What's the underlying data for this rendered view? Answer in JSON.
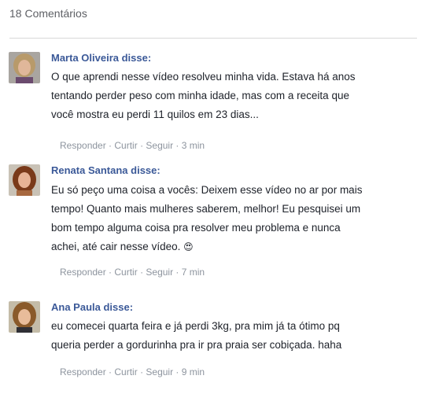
{
  "header": {
    "count_label": "18 Comentários"
  },
  "comments": [
    {
      "author": "Marta Oliveira disse:",
      "lines": [
        "O que aprendi nesse vídeo resolveu minha vida. Estava há anos",
        "tentando perder peso com minha idade, mas com a receita que",
        "você mostra eu perdi 11 quilos em 23 dias..."
      ],
      "actions": {
        "reply": "Responder",
        "like": "Curtir",
        "follow": "Seguir",
        "time": "3 min",
        "sep": " · "
      }
    },
    {
      "author": "Renata Santana disse:",
      "lines": [
        "Eu só peço uma coisa a vocês: Deixem esse vídeo no ar por mais",
        "tempo! Quanto mais mulheres saberem, melhor! Eu pesquisei um",
        "bom tempo alguma coisa pra resolver meu problema e nunca",
        "achei, até cair nesse vídeo. "
      ],
      "emoji": "😍",
      "actions": {
        "reply": "Responder",
        "like": "Curtir",
        "follow": "Seguir",
        "time": "7 min",
        "sep": " · "
      }
    },
    {
      "author": "Ana Paula disse:",
      "lines": [
        "eu comecei quarta feira e já perdi 3kg, pra mim já ta ótimo pq",
        "queria perder a gordurinha pra ir pra praia ser cobiçada. haha"
      ],
      "actions": {
        "reply": "Responder",
        "like": "Curtir",
        "follow": "Seguir",
        "time": "9 min",
        "sep": " · "
      }
    }
  ]
}
